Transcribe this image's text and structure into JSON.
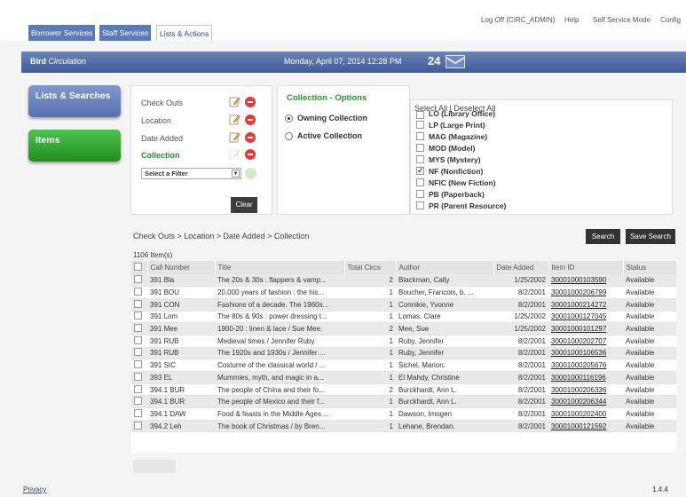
{
  "tabs": [
    {
      "label": "Borrower Services",
      "active": false
    },
    {
      "label": "Staff Services",
      "active": false
    },
    {
      "label": "Lists & Actions",
      "active": true
    }
  ],
  "top_links": [
    "Log Off (CIRC_ADMIN)",
    "Help",
    "Self Service Mode",
    "Config"
  ],
  "header": {
    "app_name": "Bird",
    "app_subtitle": "Circulation",
    "datetime": "Monday, April 07, 2014 12:28 PM",
    "message_count": "24"
  },
  "sidebar": [
    {
      "label": "Lists & Searches"
    },
    {
      "label": "Items"
    }
  ],
  "filters": {
    "rows": [
      "Check Outs",
      "Location",
      "Date Added",
      "Collection"
    ],
    "select_placeholder": "Select a Filter",
    "clear_label": "Clear"
  },
  "options": {
    "title": "Collection - Options",
    "radios": [
      {
        "label": "Owning Collection",
        "selected": true
      },
      {
        "label": "Active Collection",
        "selected": false
      }
    ]
  },
  "collection_list": {
    "select_links": "Select All | Deselect All",
    "items": [
      {
        "label": "LO (Library Office)",
        "checked": false
      },
      {
        "label": "LP (Large Print)",
        "checked": false
      },
      {
        "label": "MAG (Magazine)",
        "checked": false
      },
      {
        "label": "MOD (Model)",
        "checked": false
      },
      {
        "label": "MYS (Mystery)",
        "checked": false
      },
      {
        "label": "NF (Nonfiction)",
        "checked": true
      },
      {
        "label": "NFIC (New Fiction)",
        "checked": false
      },
      {
        "label": "PB (Paperback)",
        "checked": false
      },
      {
        "label": "PR (Parent Resource)",
        "checked": false
      }
    ]
  },
  "breadcrumb": "Check Outs > Location > Date Added > Collection",
  "search_label": "Search",
  "save_search_label": "Save Search",
  "item_count": "1106 Item(s)",
  "table": {
    "columns": [
      "Call Number",
      "Title",
      "Total Circs",
      "Author",
      "Date Added",
      "Item ID",
      "Status"
    ],
    "rows": [
      [
        "391 Bla",
        "The 20s & 30s : flappers & vamp...",
        "2",
        "Blackman, Cally",
        "1/25/2002",
        "30001000103590",
        "Available"
      ],
      [
        "391 BOU",
        "20,000 years of fashion : the his...",
        "1",
        "Boucher, Francois, b. ...",
        "8/2/2001",
        "30001000206799",
        "Available"
      ],
      [
        "391 CON",
        "Fashions of a decade. The 1960s...",
        "1",
        "Connikie, Yvonne",
        "8/2/2001",
        "30001000214272",
        "Available"
      ],
      [
        "391 Lom",
        "The 80s & 90s : power dressing t...",
        "1",
        "Lomas, Clare",
        "1/25/2002",
        "30001000127045",
        "Available"
      ],
      [
        "391 Mee",
        "1900-20 : linen & lace / Sue Mee.",
        "2",
        "Mee, Sue",
        "1/25/2002",
        "30001000101297",
        "Available"
      ],
      [
        "391 RUB",
        "Medieval times / Jennifer Ruby.",
        "1",
        "Ruby, Jennifer",
        "8/2/2001",
        "30001000202707",
        "Available"
      ],
      [
        "391 RUB",
        "The 1920s and 1930s / Jennifer ...",
        "1",
        "Ruby, Jennifer",
        "8/2/2001",
        "30001000106536",
        "Available"
      ],
      [
        "391 SIC",
        "Costume of the classical world / ...",
        "1",
        "Sichel, Marion.",
        "8/2/2001",
        "30001000205676",
        "Available"
      ],
      [
        "393 EL",
        "Mummies, myth, and magic in a...",
        "1",
        "El Mahdy, Christine",
        "8/2/2001",
        "30001000116196",
        "Available"
      ],
      [
        "394.1 BUR",
        "The people of China and their fo...",
        "2",
        "Burckhardt, Ann L.",
        "8/2/2001",
        "30001000206336",
        "Available"
      ],
      [
        "394.1 BUR",
        "The people of Mexico and their f...",
        "1",
        "Burckhardt, Ann L.",
        "8/2/2001",
        "30001000206344",
        "Available"
      ],
      [
        "394.1 DAW",
        "Food & feasts in the Middle Ages ...",
        "1",
        "Dawson, Imogen",
        "8/2/2001",
        "30001000202400",
        "Available"
      ],
      [
        "394.2 Leh",
        "The book of Christmas / by Bren...",
        "1",
        "Lehane, Brendan.",
        "8/2/2001",
        "30001000121592",
        "Available"
      ]
    ]
  },
  "footer": {
    "privacy": "Privacy",
    "version": "1.4.4"
  }
}
